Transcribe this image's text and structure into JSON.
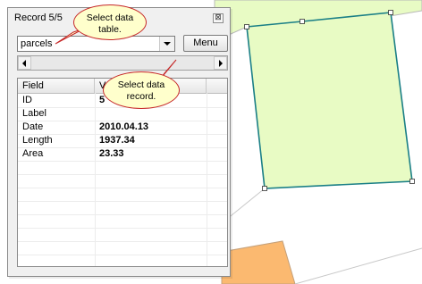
{
  "window": {
    "title": "Record 5/5",
    "close_symbol": "⊠"
  },
  "table_select": {
    "value": "parcels"
  },
  "menu_button": {
    "label": "Menu"
  },
  "grid": {
    "headers": [
      "Field",
      "V"
    ],
    "rows": [
      {
        "field": "ID",
        "value": "5"
      },
      {
        "field": "Label",
        "value": ""
      },
      {
        "field": "Date",
        "value": "2010.04.13"
      },
      {
        "field": "Length",
        "value": "1937.34"
      },
      {
        "field": "Area",
        "value": "23.33"
      }
    ]
  },
  "callouts": {
    "select_table": {
      "line1": "Select data",
      "line2": "table."
    },
    "select_record": {
      "line1": "Select data",
      "line2": "record."
    }
  },
  "colors": {
    "parcel_fill": "#e8fbc4",
    "parcel_edge": "#1a7f86",
    "neighbor_fill": "#fbb970",
    "callout_fill": "#ffffcc",
    "callout_border": "#c62828"
  }
}
